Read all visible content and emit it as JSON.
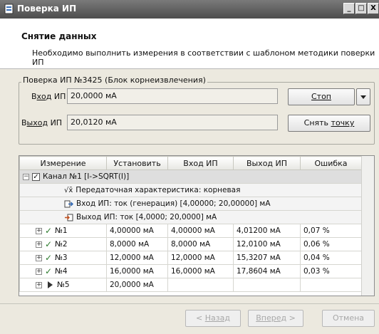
{
  "window": {
    "title": "Поверка ИП",
    "min": "_",
    "max": "□",
    "close": "X"
  },
  "header": {
    "title": "Снятие данных",
    "subtitle": "Необходимо выполнить измерения в соответствии с шаблоном методики поверки ИП"
  },
  "group": {
    "caption": "Поверка ИП №3425 (Блок корнеизвлечения)",
    "input_label_pre": "В",
    "input_label_ul": "ход",
    "input_label_post": " ИП",
    "input_value": "20,0000 мА",
    "output_label_pre": "В",
    "output_label_ul": "ыход",
    "output_label_post": " ИП",
    "output_value": "20,0120 мА",
    "stop_label": "Стоп",
    "snap_pre": "Снять ",
    "snap_ul": "точку"
  },
  "table": {
    "headers": [
      "Измерение",
      "Установить",
      "Вход ИП",
      "Выход ИП",
      "Ошибка"
    ],
    "channel": "Канал №1 [I->SQRT(I)]",
    "info": [
      "Передаточная характеристика: корневая",
      "Вход ИП: ток (генерация) [4,00000; 20,00000] мА",
      "Выход ИП: ток [4,0000; 20,0000] мА"
    ],
    "rows": [
      {
        "name": "№1",
        "set": "4,00000 мА",
        "in": "4,00000 мА",
        "out": "4,01200 мА",
        "err": "0,07 %"
      },
      {
        "name": "№2",
        "set": "8,0000 мА",
        "in": "8,0000 мА",
        "out": "12,0100 мА",
        "err": "0,06 %"
      },
      {
        "name": "№3",
        "set": "12,0000 мА",
        "in": "12,0000 мА",
        "out": "15,3207 мА",
        "err": "0,04 %"
      },
      {
        "name": "№4",
        "set": "16,0000 мА",
        "in": "16,0000 мА",
        "out": "17,8604 мА",
        "err": "0,03 %"
      },
      {
        "name": "№5",
        "set": "20,0000 мА",
        "in": "",
        "out": "",
        "err": ""
      }
    ]
  },
  "footer": {
    "back_pre": "< ",
    "back_ul": "Назад",
    "next_ul": "Вперед",
    "next_post": " >",
    "cancel": "Отмена"
  }
}
